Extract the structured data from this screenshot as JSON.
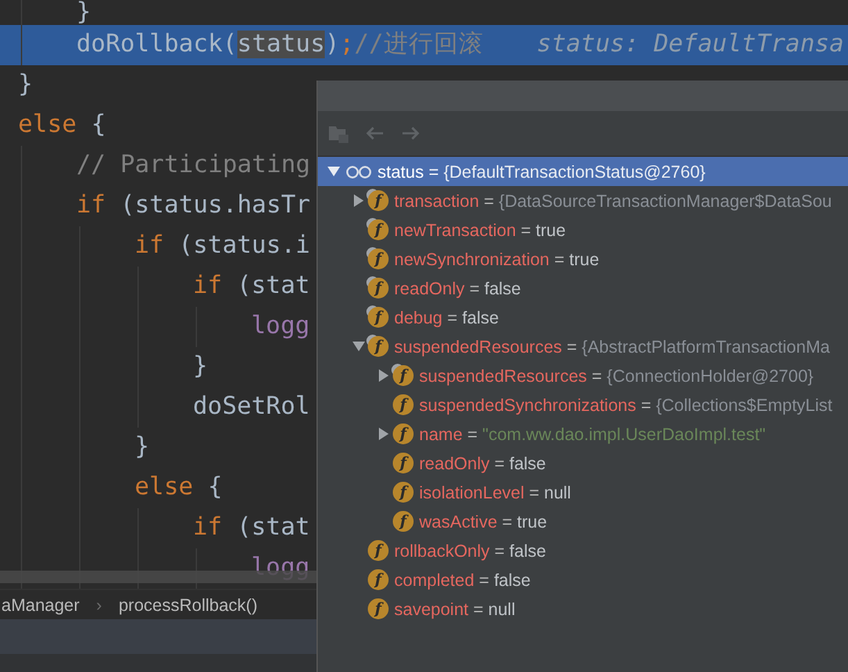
{
  "editor": {
    "lines": [
      {
        "highlighted": false,
        "tokens": [
          {
            "kind": "plain",
            "text": "    }"
          }
        ]
      },
      {
        "highlighted": true,
        "tokens": [
          {
            "kind": "plain",
            "text": "    doRollback("
          },
          {
            "kind": "usage",
            "text": "status"
          },
          {
            "kind": "plain",
            "text": ")"
          },
          {
            "kind": "keyword",
            "text": ";"
          },
          {
            "kind": "comment",
            "text": "//进行回滚"
          },
          {
            "kind": "hint",
            "text": "status: DefaultTransa"
          }
        ]
      },
      {
        "highlighted": false,
        "tokens": [
          {
            "kind": "plain",
            "text": "}"
          }
        ]
      },
      {
        "highlighted": false,
        "tokens": [
          {
            "kind": "keyword",
            "text": "else"
          },
          {
            "kind": "plain",
            "text": " {"
          }
        ]
      },
      {
        "highlighted": false,
        "tokens": [
          {
            "kind": "comment",
            "text": "    // Participating"
          }
        ]
      },
      {
        "highlighted": false,
        "tokens": [
          {
            "kind": "keyword",
            "text": "    if"
          },
          {
            "kind": "plain",
            "text": " (status.hasTr"
          }
        ]
      },
      {
        "highlighted": false,
        "tokens": [
          {
            "kind": "keyword",
            "text": "        if"
          },
          {
            "kind": "plain",
            "text": " (status.i"
          }
        ]
      },
      {
        "highlighted": false,
        "tokens": [
          {
            "kind": "keyword",
            "text": "            if"
          },
          {
            "kind": "plain",
            "text": " (stat"
          }
        ]
      },
      {
        "highlighted": false,
        "tokens": [
          {
            "kind": "field",
            "text": "                logg"
          }
        ]
      },
      {
        "highlighted": false,
        "tokens": [
          {
            "kind": "plain",
            "text": "            }"
          }
        ]
      },
      {
        "highlighted": false,
        "tokens": [
          {
            "kind": "plain",
            "text": "            doSetRol"
          }
        ]
      },
      {
        "highlighted": false,
        "tokens": [
          {
            "kind": "plain",
            "text": "        }"
          }
        ]
      },
      {
        "highlighted": false,
        "tokens": [
          {
            "kind": "keyword",
            "text": "        else"
          },
          {
            "kind": "plain",
            "text": " {"
          }
        ]
      },
      {
        "highlighted": false,
        "tokens": [
          {
            "kind": "keyword",
            "text": "            if"
          },
          {
            "kind": "plain",
            "text": " (stat"
          }
        ]
      },
      {
        "highlighted": false,
        "tokens": [
          {
            "kind": "field",
            "text": "                logg"
          }
        ]
      }
    ]
  },
  "breadcrumb": {
    "items": [
      "aManager",
      "processRollback()"
    ],
    "separator": "›"
  },
  "debugger": {
    "tree": [
      {
        "kind": "watch",
        "name": "status",
        "operator": "=",
        "value": {
          "kind": "object",
          "text": "{DefaultTransactionStatus@2760}"
        },
        "expanded": true,
        "selected": true,
        "children": [
          {
            "kind": "field",
            "badge": "f",
            "name": "transaction",
            "operator": "=",
            "value": {
              "kind": "object",
              "text": "{DataSourceTransactionManager$DataSou"
            },
            "expanded": false,
            "selected": false,
            "final": true
          },
          {
            "kind": "field",
            "badge": "f",
            "name": "newTransaction",
            "operator": "=",
            "value": {
              "kind": "primitive",
              "text": "true"
            },
            "selected": false,
            "final": true
          },
          {
            "kind": "field",
            "badge": "f",
            "name": "newSynchronization",
            "operator": "=",
            "value": {
              "kind": "primitive",
              "text": "true"
            },
            "selected": false,
            "final": true
          },
          {
            "kind": "field",
            "badge": "f",
            "name": "readOnly",
            "operator": "=",
            "value": {
              "kind": "primitive",
              "text": "false"
            },
            "selected": false,
            "final": true
          },
          {
            "kind": "field",
            "badge": "f",
            "name": "debug",
            "operator": "=",
            "value": {
              "kind": "primitive",
              "text": "false"
            },
            "selected": false,
            "final": true
          },
          {
            "kind": "field",
            "badge": "f",
            "name": "suspendedResources",
            "operator": "=",
            "value": {
              "kind": "object",
              "text": "{AbstractPlatformTransactionMa"
            },
            "expanded": true,
            "selected": false,
            "final": true,
            "children": [
              {
                "kind": "field",
                "badge": "f",
                "name": "suspendedResources",
                "operator": "=",
                "value": {
                  "kind": "object",
                  "text": "{ConnectionHolder@2700}"
                },
                "expanded": false,
                "selected": false,
                "final": true
              },
              {
                "kind": "field",
                "badge": "f",
                "name": "suspendedSynchronizations",
                "operator": "=",
                "value": {
                  "kind": "object",
                  "text": "{Collections$EmptyList"
                },
                "selected": false,
                "final": false
              },
              {
                "kind": "field",
                "badge": "f",
                "name": "name",
                "operator": "=",
                "value": {
                  "kind": "string",
                  "text": "\"com.ww.dao.impl.UserDaoImpl.test\""
                },
                "expanded": false,
                "selected": false,
                "final": false
              },
              {
                "kind": "field",
                "badge": "f",
                "name": "readOnly",
                "operator": "=",
                "value": {
                  "kind": "primitive",
                  "text": "false"
                },
                "selected": false,
                "final": false
              },
              {
                "kind": "field",
                "badge": "f",
                "name": "isolationLevel",
                "operator": "=",
                "value": {
                  "kind": "primitive",
                  "text": "null"
                },
                "selected": false,
                "final": false
              },
              {
                "kind": "field",
                "badge": "f",
                "name": "wasActive",
                "operator": "=",
                "value": {
                  "kind": "primitive",
                  "text": "true"
                },
                "selected": false,
                "final": false
              }
            ]
          },
          {
            "kind": "field",
            "badge": "f",
            "name": "rollbackOnly",
            "operator": "=",
            "value": {
              "kind": "primitive",
              "text": "false"
            },
            "selected": false,
            "final": false
          },
          {
            "kind": "field",
            "badge": "f",
            "name": "completed",
            "operator": "=",
            "value": {
              "kind": "primitive",
              "text": "false"
            },
            "selected": false,
            "final": false
          },
          {
            "kind": "field",
            "badge": "f",
            "name": "savepoint",
            "operator": "=",
            "value": {
              "kind": "primitive",
              "text": "null"
            },
            "selected": false,
            "final": false
          }
        ]
      }
    ]
  }
}
